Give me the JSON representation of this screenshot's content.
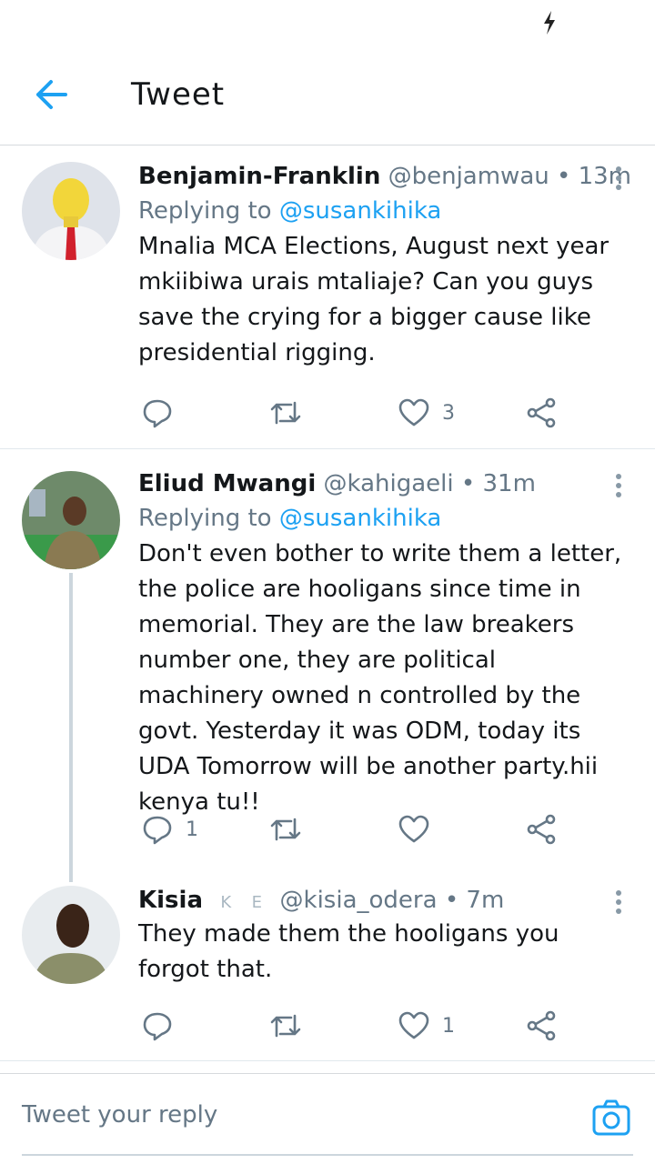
{
  "header": {
    "title": "Tweet"
  },
  "tweets": [
    {
      "name": "Benjamin-Franklin",
      "handle": "@benjamwau",
      "time": "• 13m",
      "replying_label": "Replying to",
      "replying_to": "@susankihika",
      "text": "Mnalia MCA Elections, August next year mkiibiwa urais mtaliaje? Can you guys save the crying for a bigger cause like presidential rigging.",
      "reply_count": "",
      "retweet_count": "",
      "like_count": "3"
    },
    {
      "name": "Eliud Mwangi",
      "handle": "@kahigaeli",
      "time": "• 31m",
      "replying_label": "Replying to",
      "replying_to": "@susankihika",
      "text": "Don't even bother to write them a letter, the police are hooligans since time in memorial. They are the law breakers number one, they are political machinery owned n controlled by the govt. Yesterday it was ODM, today its UDA Tomorrow will be another party.hii kenya tu!!",
      "reply_count": "1",
      "retweet_count": "",
      "like_count": ""
    },
    {
      "name": "Kisia",
      "badges": [
        "K",
        "E"
      ],
      "handle": "@kisia_odera",
      "time": "• 7m",
      "text": "They made them the hooligans you forgot that.",
      "reply_count": "",
      "retweet_count": "",
      "like_count": "1"
    }
  ],
  "composer": {
    "placeholder": "Tweet your reply"
  },
  "colors": {
    "accent": "#1da1f2",
    "muted": "#657786",
    "icon": "#657786",
    "divider": "#e1e8ed"
  },
  "icons": [
    "lightning-icon",
    "back-arrow-icon",
    "reply-icon",
    "retweet-icon",
    "like-icon",
    "share-icon",
    "more-icon",
    "camera-icon"
  ]
}
